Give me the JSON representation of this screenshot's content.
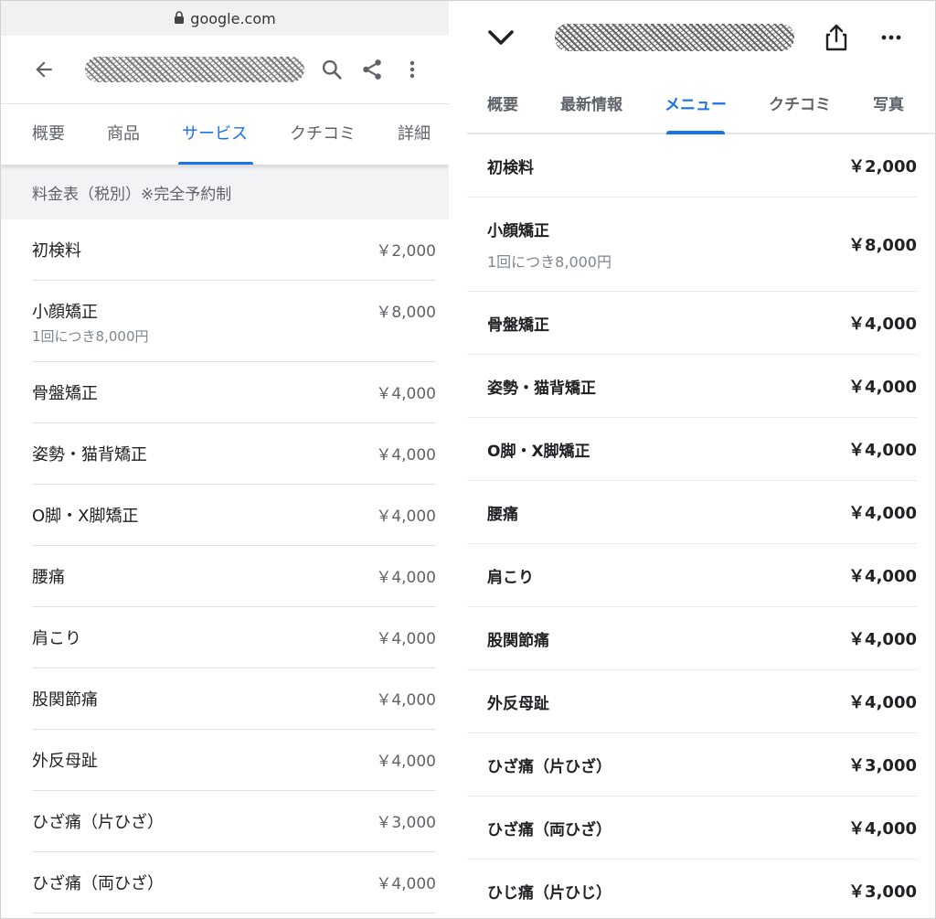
{
  "browser": {
    "url": "google.com"
  },
  "left": {
    "tabs": [
      {
        "label": "概要",
        "active": false
      },
      {
        "label": "商品",
        "active": false
      },
      {
        "label": "サービス",
        "active": true
      },
      {
        "label": "クチコミ",
        "active": false
      },
      {
        "label": "詳細",
        "active": false
      }
    ],
    "section_title": "料金表（税別）※完全予約制",
    "items": [
      {
        "name": "初検料",
        "price": "￥2,000"
      },
      {
        "name": "小顔矯正",
        "sub": "1回につき8,000円",
        "price": "￥8,000"
      },
      {
        "name": "骨盤矯正",
        "price": "￥4,000"
      },
      {
        "name": "姿勢・猫背矯正",
        "price": "￥4,000"
      },
      {
        "name": "O脚・X脚矯正",
        "price": "￥4,000"
      },
      {
        "name": "腰痛",
        "price": "￥4,000"
      },
      {
        "name": "肩こり",
        "price": "￥4,000"
      },
      {
        "name": "股関節痛",
        "price": "￥4,000"
      },
      {
        "name": "外反母趾",
        "price": "￥4,000"
      },
      {
        "name": "ひざ痛（片ひざ）",
        "price": "￥3,000"
      },
      {
        "name": "ひざ痛（両ひざ）",
        "price": "￥4,000"
      }
    ]
  },
  "right": {
    "tabs": [
      {
        "label": "概要",
        "active": false
      },
      {
        "label": "最新情報",
        "active": false
      },
      {
        "label": "メニュー",
        "active": true
      },
      {
        "label": "クチコミ",
        "active": false
      },
      {
        "label": "写真",
        "active": false
      }
    ],
    "items": [
      {
        "name": "初検料",
        "price": "￥2,000"
      },
      {
        "name": "小顔矯正",
        "sub": "1回につき8,000円",
        "price": "￥8,000"
      },
      {
        "name": "骨盤矯正",
        "price": "￥4,000"
      },
      {
        "name": "姿勢・猫背矯正",
        "price": "￥4,000"
      },
      {
        "name": "O脚・X脚矯正",
        "price": "￥4,000"
      },
      {
        "name": "腰痛",
        "price": "￥4,000"
      },
      {
        "name": "肩こり",
        "price": "￥4,000"
      },
      {
        "name": "股関節痛",
        "price": "￥4,000"
      },
      {
        "name": "外反母趾",
        "price": "￥4,000"
      },
      {
        "name": "ひざ痛（片ひざ）",
        "price": "￥3,000"
      },
      {
        "name": "ひざ痛（両ひざ）",
        "price": "￥4,000"
      },
      {
        "name": "ひじ痛（片ひじ）",
        "price": "￥3,000"
      }
    ]
  },
  "icons": {
    "lock": "lock-icon",
    "back": "arrow-back-icon",
    "search": "search-icon",
    "share": "share-icon",
    "more": "more-vert-icon",
    "chevron": "chevron-down-icon",
    "upload": "share-upload-icon",
    "more_h": "more-horiz-icon"
  },
  "colors": {
    "accent": "#1a73e8",
    "section_bg": "#f1f3f4"
  }
}
